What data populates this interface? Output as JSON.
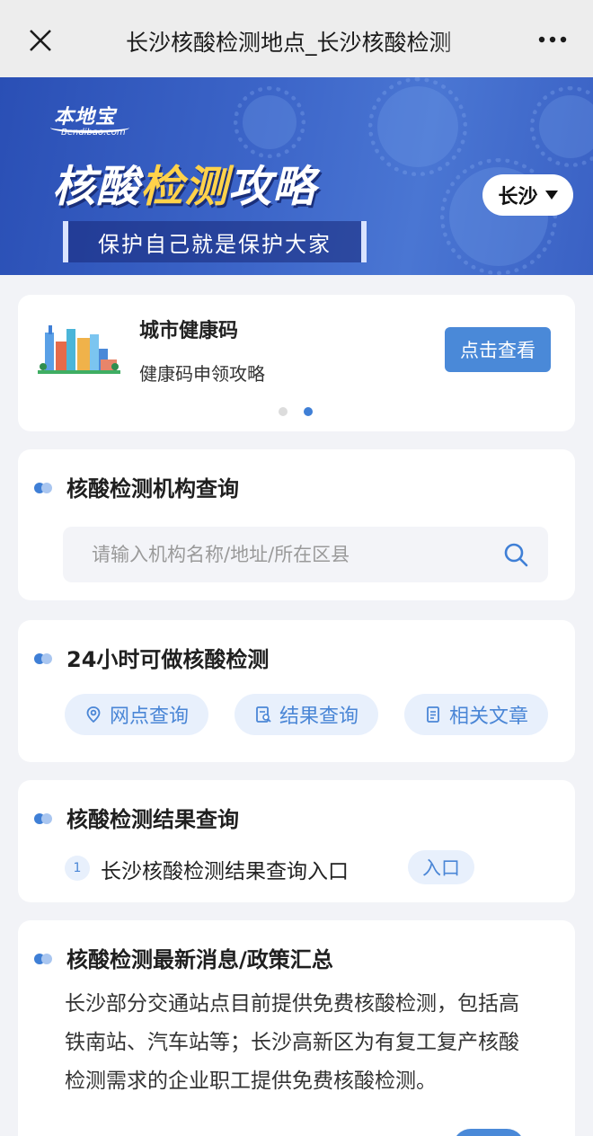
{
  "navbar": {
    "title": "长沙核酸检测地点_长沙核酸检测",
    "close_icon": "close-icon",
    "more_icon": "more-dots-icon"
  },
  "banner": {
    "logo": "本地宝",
    "logo_sub": "Bendibao.com",
    "title_part1": "核酸",
    "title_part2": "检测",
    "title_part3": "攻略",
    "slogan": "保护自己就是保护大家",
    "city": "长沙",
    "colors": {
      "bg": "#2f56bd",
      "highlight": "#ffd24a"
    }
  },
  "health_card": {
    "title": "城市健康码",
    "subtitle": "健康码申领攻略",
    "button": "点击查看",
    "carousel_total": 2,
    "carousel_active": 2
  },
  "search_section": {
    "title": "核酸检测机构查询",
    "placeholder": "请输入机构名称/地址/所在区县"
  },
  "h24_section": {
    "title": "24小时可做核酸检测",
    "chips": [
      {
        "label": "网点查询",
        "icon": "location-pin-icon"
      },
      {
        "label": "结果查询",
        "icon": "search-document-icon"
      },
      {
        "label": "相关文章",
        "icon": "article-icon"
      }
    ]
  },
  "result_section": {
    "title": "核酸检测结果查询",
    "items": [
      {
        "num": "1",
        "label": "长沙核酸检测结果查询入口",
        "action": "入口"
      }
    ]
  },
  "news_section": {
    "title": "核酸检测最新消息/政策汇总",
    "body": "长沙部分交通站点目前提供免费核酸检测，包括高铁南站、汽车站等；长沙高新区为有复工复产核酸检测需求的企业职工提供免费核酸检测。"
  },
  "colors": {
    "accent": "#3f7fd6",
    "chip_bg": "#e8f0fc",
    "page_bg": "#f2f3f7"
  }
}
